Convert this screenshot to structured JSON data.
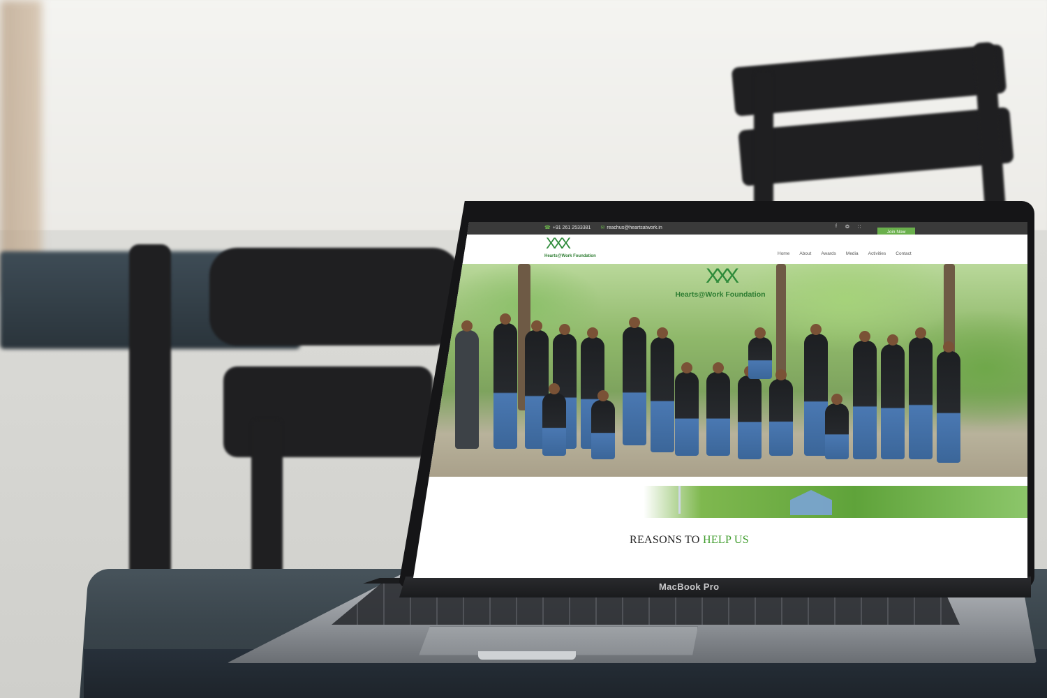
{
  "device": {
    "brand": "MacBook Pro"
  },
  "topbar": {
    "phone": "+91 261 2533381",
    "email": "reachus@heartsatwork.in",
    "social_icons": [
      "facebook-icon",
      "twitter-icon",
      "rss-icon"
    ],
    "join_label": "Join Now"
  },
  "header": {
    "logo_text": "Hearts@Work Foundation",
    "nav": [
      "Home",
      "About",
      "Awards",
      "Media",
      "Activities",
      "Contact"
    ]
  },
  "hero": {
    "logo_text": "Hearts@Work Foundation"
  },
  "section": {
    "title_part1": "REASONS TO ",
    "title_part2": "HELP US"
  },
  "colors": {
    "accent_green": "#6ab04c",
    "topbar_bg": "#3a3a3a",
    "logo_green": "#2e7d32"
  }
}
